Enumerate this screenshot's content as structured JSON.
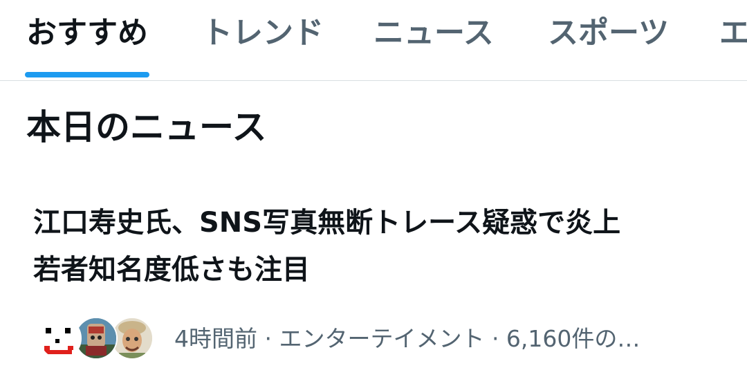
{
  "tabs": [
    {
      "label": "おすすめ",
      "active": true
    },
    {
      "label": "トレンド",
      "active": false
    },
    {
      "label": "ニュース",
      "active": false
    },
    {
      "label": "スポーツ",
      "active": false
    },
    {
      "label": "エ",
      "active": false
    }
  ],
  "colors": {
    "accent": "#1d9bf0",
    "text_primary": "#0f1419",
    "text_secondary": "#536471",
    "divider": "#d9dee2"
  },
  "section": {
    "title": "本日のニュース"
  },
  "news": {
    "headline_line1": "江口寿史氏、SNS写真無断トレース疑惑で炎上",
    "headline_line2": "若者知名度低さも注目",
    "meta": "4時間前 · エンターテイメント · 6,160件の…",
    "avatars": [
      "smiley-face-avatar",
      "mascot-photo-avatar",
      "illustrated-portrait-avatar"
    ]
  }
}
